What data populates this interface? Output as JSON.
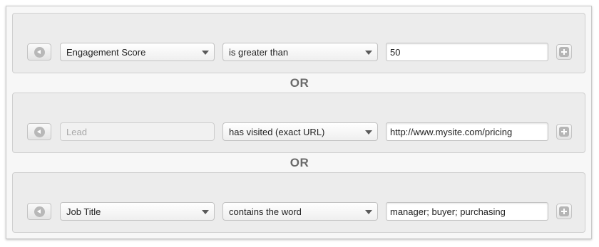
{
  "separator_label": "OR",
  "rules": [
    {
      "field": "Engagement Score",
      "field_disabled": false,
      "operator": "is greater than",
      "value": "50"
    },
    {
      "field": "Lead",
      "field_disabled": true,
      "operator": "has visited (exact URL)",
      "value": "http://www.mysite.com/pricing"
    },
    {
      "field": "Job Title",
      "field_disabled": false,
      "operator": "contains the word",
      "value": "manager; buyer; purchasing"
    }
  ],
  "icons": {
    "remove": "remove-rule-icon",
    "add": "add-rule-icon",
    "dropdown": "chevron-down-icon"
  }
}
